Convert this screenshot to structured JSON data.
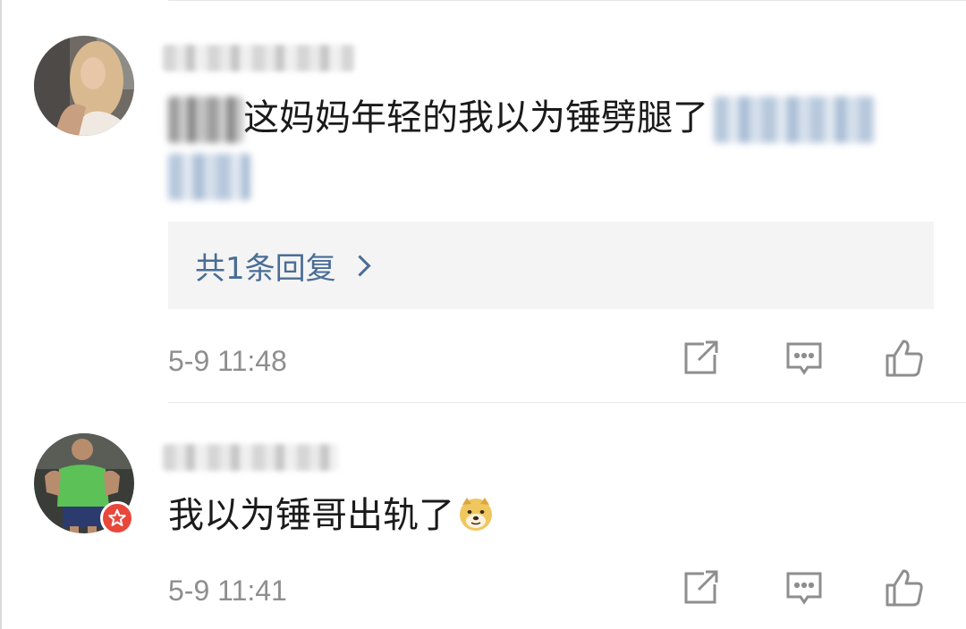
{
  "comments": [
    {
      "text_visible": "这妈妈年轻的我以为锤劈腿了",
      "reply_count_label": "共1条回复",
      "timestamp": "5-9 11:48",
      "actions": {
        "share_icon": "share-edit-icon",
        "comment_icon": "comment-bubble-icon",
        "like_icon": "thumbs-up-icon"
      }
    },
    {
      "text_visible": "我以为锤哥出轨了",
      "emoji": "doge-emoji",
      "timestamp": "5-9 11:41",
      "actions": {
        "share_icon": "share-edit-icon",
        "comment_icon": "comment-bubble-icon",
        "like_icon": "thumbs-up-icon"
      }
    }
  ],
  "colors": {
    "link_blue": "#496d96",
    "meta_gray": "#8e8e8e",
    "badge_red": "#e8473a",
    "reply_bg": "#f4f4f4"
  }
}
